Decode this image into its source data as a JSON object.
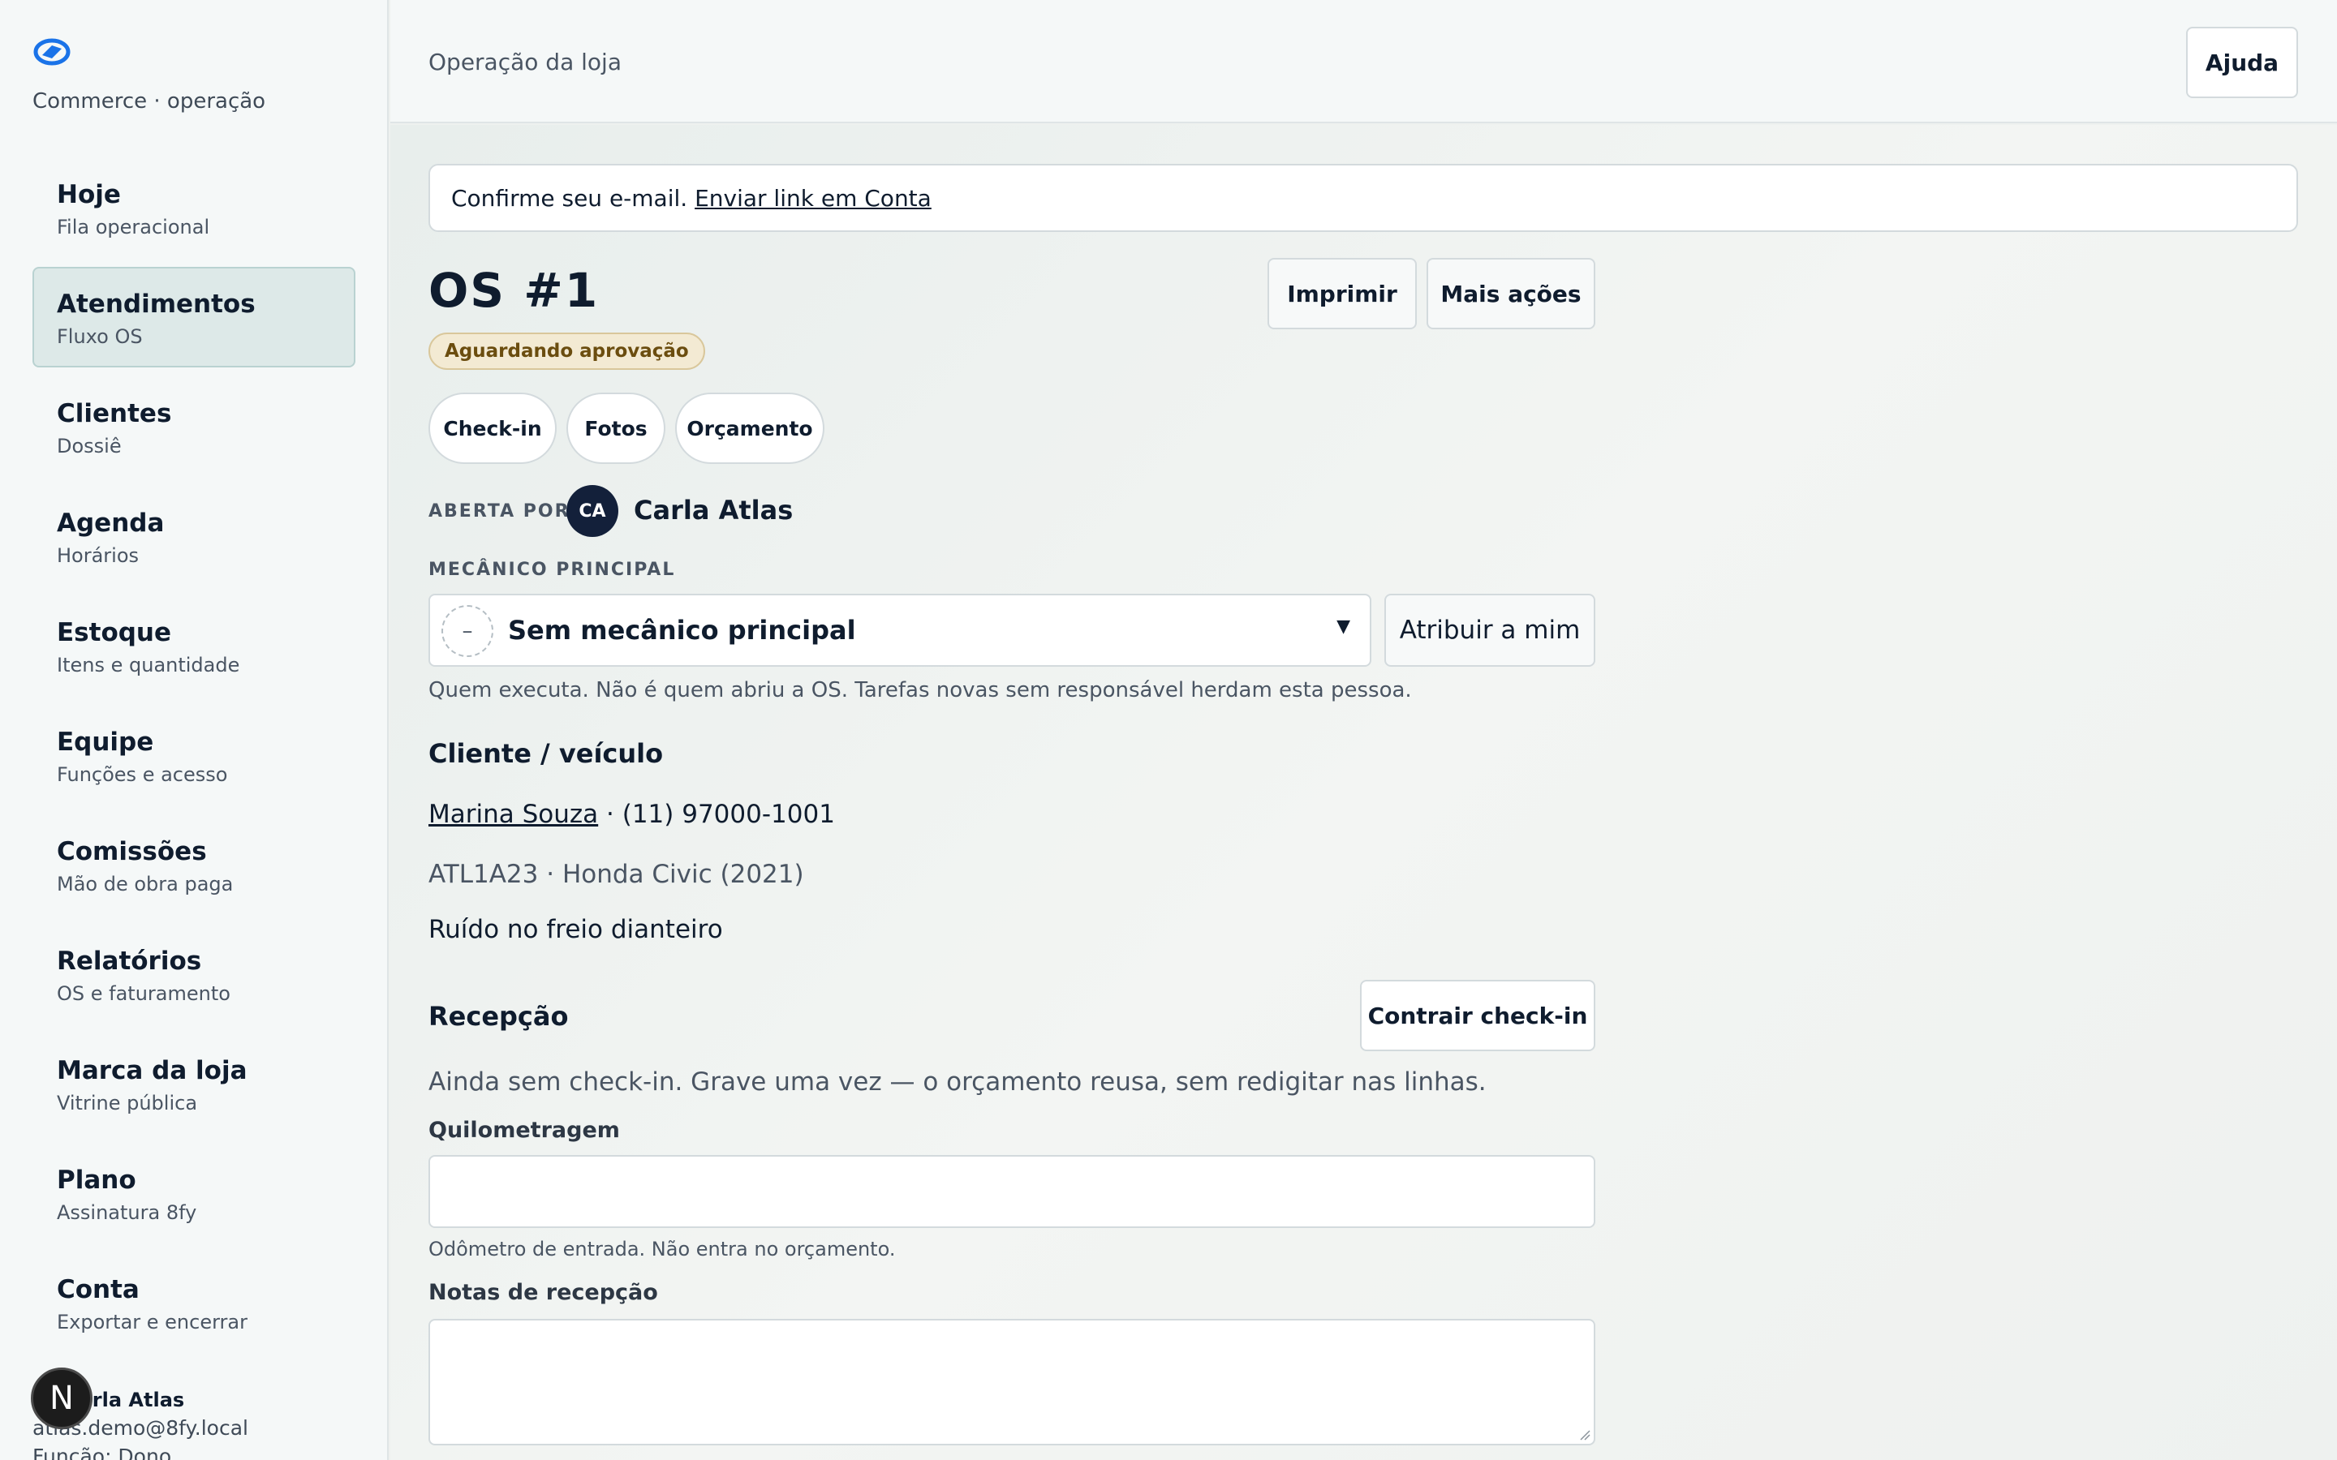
{
  "sidebar": {
    "brand_subtitle": "Commerce · operação",
    "items": [
      {
        "title": "Hoje",
        "subtitle": "Fila operacional"
      },
      {
        "title": "Atendimentos",
        "subtitle": "Fluxo OS"
      },
      {
        "title": "Clientes",
        "subtitle": "Dossiê"
      },
      {
        "title": "Agenda",
        "subtitle": "Horários"
      },
      {
        "title": "Estoque",
        "subtitle": "Itens e quantidade"
      },
      {
        "title": "Equipe",
        "subtitle": "Funções e acesso"
      },
      {
        "title": "Comissões",
        "subtitle": "Mão de obra paga"
      },
      {
        "title": "Relatórios",
        "subtitle": "OS e faturamento"
      },
      {
        "title": "Marca da loja",
        "subtitle": "Vitrine pública"
      },
      {
        "title": "Plano",
        "subtitle": "Assinatura 8fy"
      },
      {
        "title": "Conta",
        "subtitle": "Exportar e encerrar"
      }
    ],
    "active_index": 1,
    "user": {
      "name": "Carla Atlas",
      "email": "atlas.demo@8fy.local",
      "role": "Função: Dono"
    },
    "floating_badge": "N"
  },
  "header": {
    "title": "Operação da loja",
    "help_label": "Ajuda"
  },
  "notice": {
    "text": "Confirme seu e-mail.",
    "link": "Enviar link em Conta"
  },
  "order": {
    "title": "OS #1",
    "status": "Aguardando aprovação",
    "print_label": "Imprimir",
    "more_label": "Mais ações",
    "tabs": [
      "Check-in",
      "Fotos",
      "Orçamento"
    ],
    "opened_by_label": "ABERTA POR",
    "opened_by_initials": "CA",
    "opened_by_name": "Carla Atlas",
    "mechanic_label": "MECÂNICO PRINCIPAL",
    "mechanic_placeholder_symbol": "–",
    "mechanic_value": "Sem mecânico principal",
    "assign_label": "Atribuir a mim",
    "mechanic_help": "Quem executa. Não é quem abriu a OS. Tarefas novas sem responsável herdam esta pessoa."
  },
  "customer": {
    "section_title": "Cliente / veículo",
    "name": "Marina Souza",
    "phone": " · (11) 97000-1001",
    "vehicle": "ATL1A23 · Honda Civic (2021)",
    "complaint": "Ruído no freio dianteiro"
  },
  "reception": {
    "section_title": "Recepção",
    "checkin_button": "Contrair check-in",
    "description": "Ainda sem check-in. Grave uma vez — o orçamento reusa, sem redigitar nas linhas.",
    "mileage_label": "Quilometragem",
    "mileage_value": "",
    "mileage_help": "Odômetro de entrada. Não entra no orçamento.",
    "notes_label": "Notas de recepção",
    "notes_value": ""
  },
  "colors": {
    "accent": "#1a73e8",
    "active_nav_bg": "#dde9e8",
    "status_bg": "#f3ead3",
    "status_text": "#6b4d0f",
    "avatar_bg": "#13203a"
  }
}
